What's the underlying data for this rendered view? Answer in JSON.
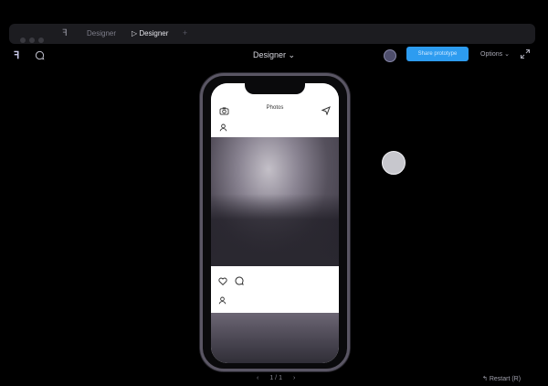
{
  "tabbar": {
    "logo": "ꟻ",
    "tabs": [
      {
        "label": "Designer"
      },
      {
        "label": "▷ Designer"
      }
    ],
    "new_tab": "+"
  },
  "toolbar": {
    "app_logo": "ꟻ",
    "title": "Designer",
    "title_chevron": "⌄",
    "share_label": "Share prototype",
    "options_label": "Options",
    "options_chevron": "⌄"
  },
  "phone": {
    "app_title": "Photos"
  },
  "pager": {
    "prev": "‹",
    "label": "1 / 1",
    "next": "›"
  },
  "restart": {
    "label": "Restart (R)"
  },
  "icons": {
    "comment": "comment-icon",
    "camera": "camera-icon",
    "send": "send-icon",
    "user": "user-icon",
    "heart": "heart-icon",
    "bubble": "bubble-icon",
    "expand": "expand-icon",
    "restart": "restart-icon"
  },
  "colors": {
    "background": "#000000",
    "accent": "#2d9cf0",
    "phone_frame": "#5a5664"
  }
}
